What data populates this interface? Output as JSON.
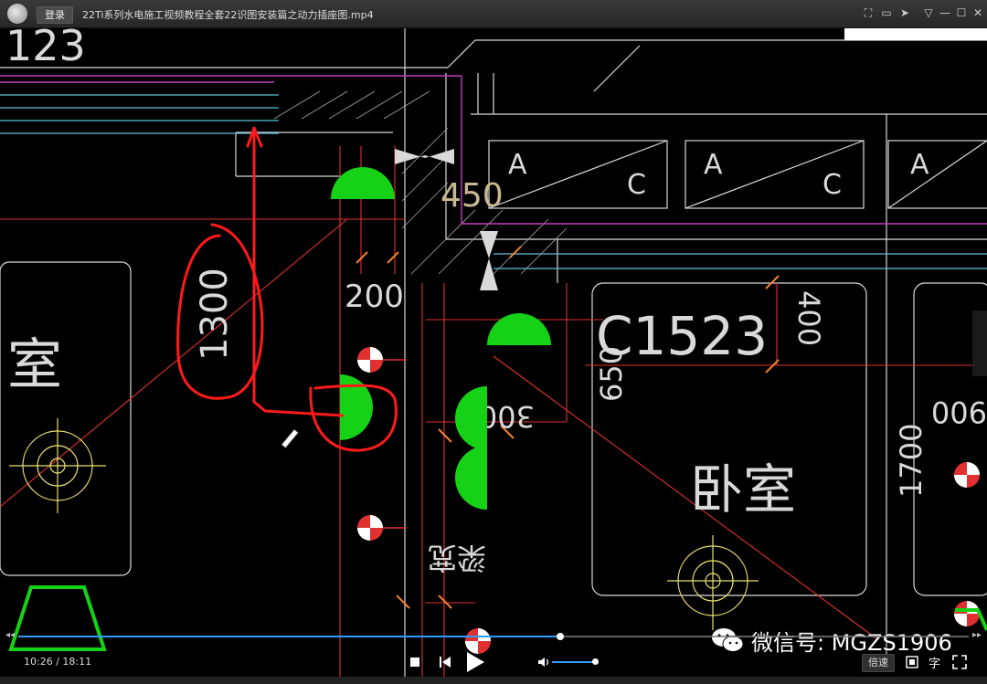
{
  "window": {
    "login_label": "登录",
    "title": "22Ti系列水电施工视频教程全套22识图安装篇之动力插座图.mp4",
    "icons": [
      "screenshot-icon",
      "folder-icon",
      "pin-icon",
      "menu-icon",
      "minimize-icon",
      "maximize-icon",
      "close-icon"
    ]
  },
  "drawing": {
    "labels": {
      "top_left_fragment": "123",
      "dim_450": "450",
      "dim_200": "200",
      "dim_1300": "1300",
      "code_c1523": "C1523",
      "dim_650": "650",
      "dim_400": "400",
      "dim_300": "300",
      "dim_1700": "1700",
      "dim_900": "900",
      "room_left": "室",
      "room_bedroom": "卧室",
      "beam_width": "梁宽",
      "box_a": "A",
      "box_c": "C"
    },
    "colors": {
      "red_line": "#e03030",
      "green_symbol": "#16d216",
      "magenta": "#c040c0",
      "cyan": "#5fbfd8",
      "white": "#d9d9d9",
      "yellow": "#e8e070",
      "orange": "#f08030"
    }
  },
  "player": {
    "current_time": "10:26",
    "total_time": "18:11",
    "time_display": "10:26 / 18:11",
    "progress_fraction": 0.57,
    "volume_fraction": 0.9,
    "speed_label": "倍速",
    "subtitle_label": "字",
    "controls": [
      "stop-icon",
      "prev-icon",
      "play-icon",
      "volume-icon",
      "screen-icon",
      "subtitle-icon",
      "fullscreen-icon"
    ]
  },
  "watermark": {
    "text": "微信号: MGZS1906"
  }
}
